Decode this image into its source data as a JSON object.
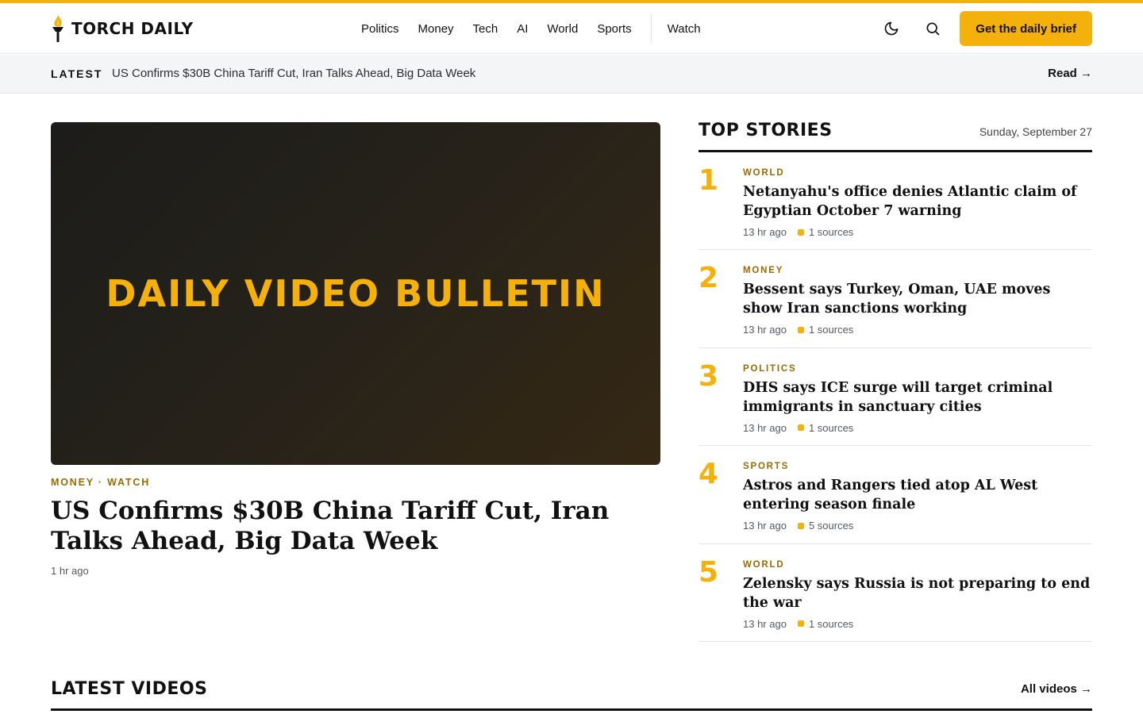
{
  "brand": {
    "name": "TORCH DAILY",
    "accent_color": "#f5b10b"
  },
  "nav": {
    "items": [
      {
        "label": "Politics"
      },
      {
        "label": "Money"
      },
      {
        "label": "Tech"
      },
      {
        "label": "AI"
      },
      {
        "label": "World"
      },
      {
        "label": "Sports"
      }
    ],
    "watch_label": "Watch"
  },
  "tools": {
    "theme_icon": "moon-icon",
    "search_icon": "search-icon",
    "cta_label": "Get the daily brief"
  },
  "latest": {
    "label": "LATEST",
    "headline": "US Confirms $30B China Tariff Cut, Iran Talks Ahead, Big Data Week",
    "read_label": "Read →"
  },
  "hero": {
    "media_title": "DAILY VIDEO BULLETIN",
    "kicker": "MONEY · WATCH",
    "title": "US Confirms $30B China Tariff Cut, Iran Talks Ahead, Big Data Week",
    "time": "1 hr ago"
  },
  "top_stories": {
    "title": "TOP STORIES",
    "date": "Sunday, September 27",
    "items": [
      {
        "rank": "1",
        "category": "WORLD",
        "title": "Netanyahu's office denies Atlantic claim of Egyptian October 7 warning",
        "time": "13 hr ago",
        "sources": "1 sources"
      },
      {
        "rank": "2",
        "category": "MONEY",
        "title": "Bessent says Turkey, Oman, UAE moves show Iran sanctions working",
        "time": "13 hr ago",
        "sources": "1 sources"
      },
      {
        "rank": "3",
        "category": "POLITICS",
        "title": "DHS says ICE surge will target criminal immigrants in sanctuary cities",
        "time": "13 hr ago",
        "sources": "1 sources"
      },
      {
        "rank": "4",
        "category": "SPORTS",
        "title": "Astros and Rangers tied atop AL West entering season finale",
        "time": "13 hr ago",
        "sources": "5 sources"
      },
      {
        "rank": "5",
        "category": "WORLD",
        "title": "Zelensky says Russia is not preparing to end the war",
        "time": "13 hr ago",
        "sources": "1 sources"
      }
    ]
  },
  "latest_videos": {
    "title": "LATEST VIDEOS",
    "link_label": "All videos →"
  }
}
